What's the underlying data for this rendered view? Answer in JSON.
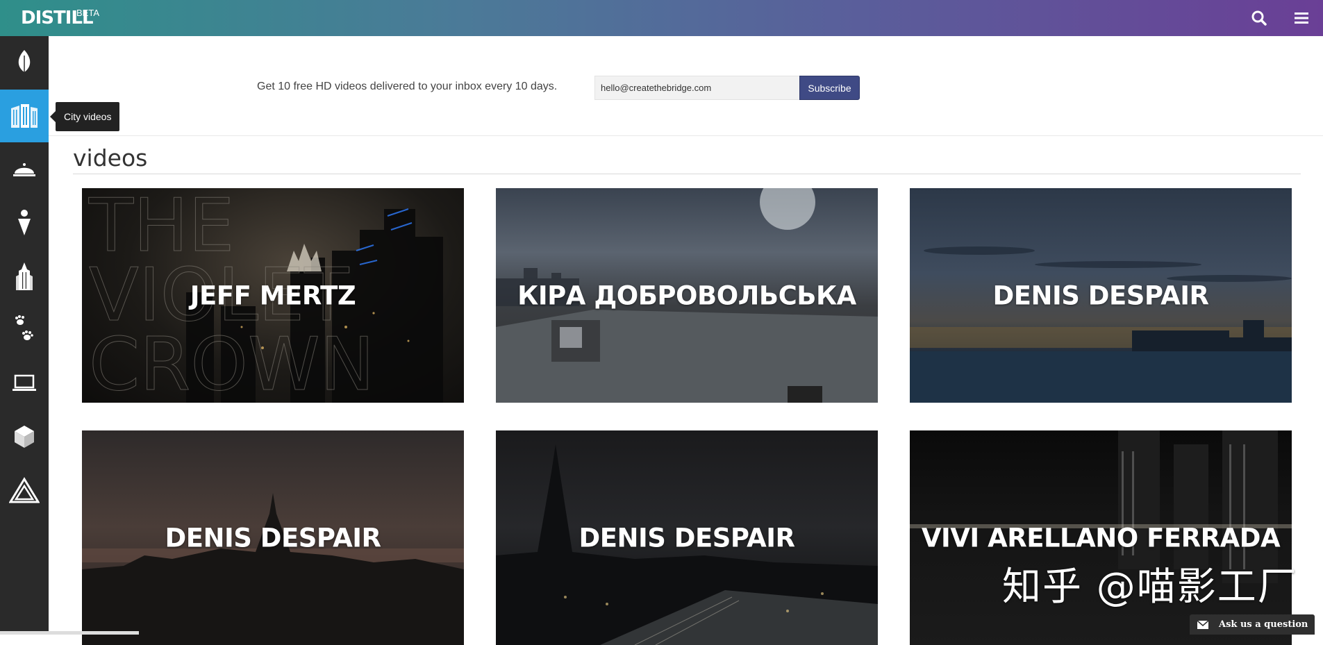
{
  "app": {
    "logo": "DISTILL",
    "badge": "BETA"
  },
  "topbar": {
    "search_icon": "search-icon",
    "menu_icon": "hamburger-menu-icon"
  },
  "sidebar": {
    "items": [
      {
        "icon": "leaf-icon",
        "active": false
      },
      {
        "icon": "city-buildings-icon",
        "active": true
      },
      {
        "icon": "food-dome-icon",
        "active": false
      },
      {
        "icon": "person-pin-icon",
        "active": false
      },
      {
        "icon": "skyscraper-icon",
        "active": false
      },
      {
        "icon": "paw-prints-icon",
        "active": false
      },
      {
        "icon": "laptop-icon",
        "active": false
      },
      {
        "icon": "cube-icon",
        "active": false
      },
      {
        "icon": "triangle-logo-icon",
        "active": false
      }
    ],
    "tooltip": "City videos"
  },
  "subscribe": {
    "text": "Get 10 free HD videos delivered to your inbox every 10 days.",
    "email_value": "hello@createthebridge.com",
    "button_label": "Subscribe"
  },
  "section": {
    "title": "videos"
  },
  "videos": [
    {
      "title": "JEFF MERTZ"
    },
    {
      "title": "КІРА ДОБРОВОЛЬСЬКА"
    },
    {
      "title": "DENIS DESPAIR"
    },
    {
      "title": "DENIS DESPAIR"
    },
    {
      "title": "DENIS DESPAIR"
    },
    {
      "title": "VIVI ARELLANO FERRADA"
    }
  ],
  "card1_overlay": {
    "line1": "THE",
    "line2": "VIOLET",
    "line3": "CROWN"
  },
  "watermark": "知乎 @喵影工厂",
  "chat": {
    "label": "Ask us a question",
    "icon": "mail-icon"
  },
  "colors": {
    "accent": "#2a9fe0",
    "subscribe_button": "#3f4a85",
    "sidebar": "#2a2a2a"
  }
}
